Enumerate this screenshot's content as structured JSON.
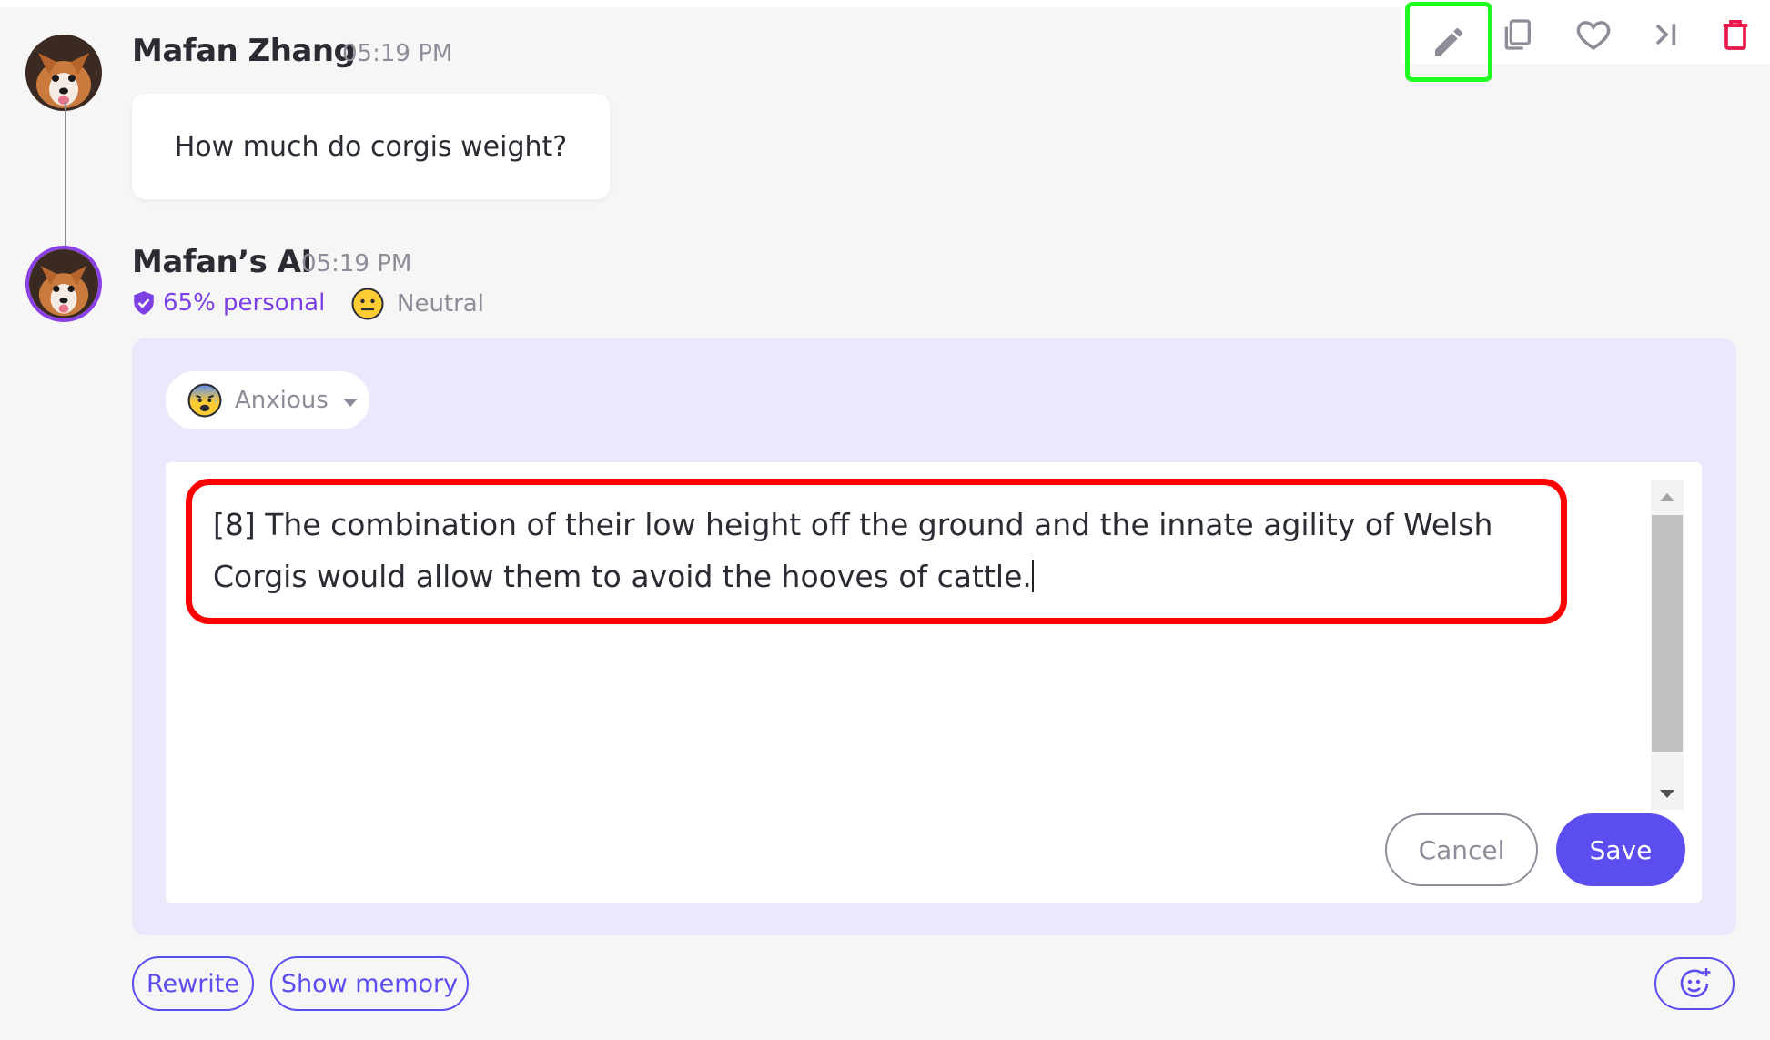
{
  "toolbar": {
    "buttons": [
      {
        "icon": "pencil-icon",
        "state": "active"
      },
      {
        "icon": "copy-icon"
      },
      {
        "icon": "heart-icon"
      },
      {
        "icon": "skip-to-end-icon"
      },
      {
        "icon": "trash-icon"
      }
    ]
  },
  "user_message": {
    "author": "Mafan Zhang",
    "time": "05:19 PM",
    "text": "How much do corgis weight?"
  },
  "ai_message": {
    "author": "Mafan’s AI",
    "time": "05:19 PM",
    "personal_badge": "65% personal",
    "mood_label": "Neutral",
    "edit": {
      "selected_emotion": "Anxious",
      "text": "[8] The combination of their low height off the ground and the innate agility of Welsh Corgis would allow them to avoid the hooves of cattle.",
      "cancel_label": "Cancel",
      "save_label": "Save"
    }
  },
  "actions": {
    "rewrite_label": "Rewrite",
    "show_memory_label": "Show memory"
  },
  "colors": {
    "accent": "#5b4df0",
    "personal": "#7b3fe4",
    "delete": "#e8174a",
    "active_outline": "#22ff22",
    "highlight_outline": "#ff0000",
    "edit_panel_bg": "#ebe8fb"
  }
}
